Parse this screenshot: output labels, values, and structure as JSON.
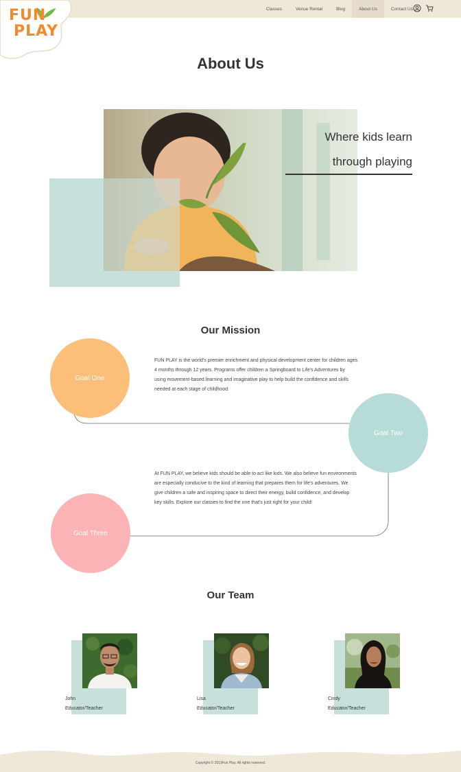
{
  "brand": {
    "line1": "FUN",
    "line2": "PLAY",
    "accent": "#f08a2a",
    "leaf_color": "#6bbf44"
  },
  "nav": {
    "items": [
      "Classes",
      "Venue Rental",
      "Blog",
      "About Us",
      "Contact Us"
    ],
    "active": "About Us",
    "icons": [
      "user-icon",
      "cart-icon"
    ]
  },
  "page": {
    "title": "About Us"
  },
  "hero": {
    "tagline_line1": "Where kids learn",
    "tagline_line2": "through playing"
  },
  "mission": {
    "title": "Our Mission",
    "goals": [
      "Goal One",
      "Goal Two",
      "Goal Three"
    ],
    "paragraph1": "FUN PLAY is the world's premier enrichment and physical development center for children ages 4 months through 12 years. Programs offer children a Springboard to Life's Adventures by using movement-based learning and imaginative play to help build the confidence and skills needed at each stage of childhood.",
    "paragraph2": "At FUN PLAY, we believe kids should be able to act like kids. We also believe fun environments are especially conducive to the kind of learning that prepares them for life's adventures. We give children a safe and inspiring space to direct their energy, build confidence, and develop key skills. Explore our classes to find the one that's just right for your child!"
  },
  "team": {
    "title": "Our Team",
    "members": [
      {
        "name": "John",
        "role": "Educator/Teacher"
      },
      {
        "name": "Lisa",
        "role": "Educator/Teacher"
      },
      {
        "name": "Cindy",
        "role": "Educator/Teacher"
      }
    ]
  },
  "footer": {
    "copyright": "Copyright © 2019Fun Play. All rights reserved."
  },
  "colors": {
    "topbar": "#efe7d8",
    "teal": "#c8e0dc",
    "goal_one": "#fcbf7a",
    "goal_two": "#b7dbd6",
    "goal_three": "#fbb3b5"
  }
}
